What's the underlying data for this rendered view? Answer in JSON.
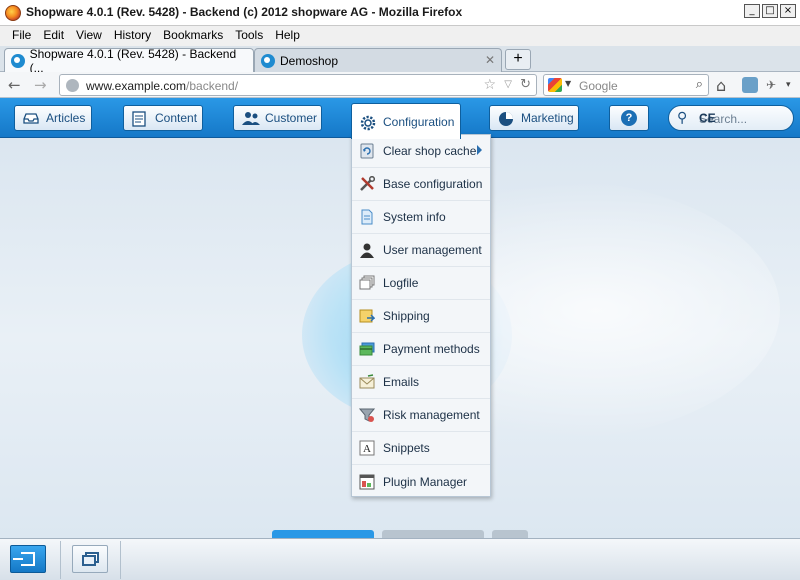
{
  "window": {
    "title": "Shopware 4.0.1 (Rev. 5428) - Backend (c) 2012 shopware AG - Mozilla Firefox",
    "controls": [
      "_",
      "□",
      "×"
    ]
  },
  "menubar": {
    "items": [
      "File",
      "Edit",
      "View",
      "History",
      "Bookmarks",
      "Tools",
      "Help"
    ]
  },
  "tabs": [
    {
      "label": "Shopware 4.0.1 (Rev. 5428) - Backend (...",
      "active": true
    },
    {
      "label": "Demoshop",
      "active": false
    }
  ],
  "newtab_label": "+",
  "nav": {
    "back": "←",
    "forward": "→",
    "url_host": "www.example.com",
    "url_path": "/backend/",
    "star": "☆",
    "dropdown": "▽",
    "reload": "↻",
    "search_placeholder": "Google",
    "search_icon": "search-icon",
    "home": "⌂",
    "addon": "✈",
    "menu_arrow": "▾"
  },
  "app_toolbar": {
    "buttons": [
      {
        "label": "Articles",
        "icon": "articles-icon"
      },
      {
        "label": "Content",
        "icon": "content-icon"
      },
      {
        "label": "Customer",
        "icon": "customer-icon"
      },
      {
        "label": "Configuration",
        "icon": "gear-icon"
      },
      {
        "label": "Marketing",
        "icon": "pie-chart-icon"
      }
    ],
    "help_label": "?",
    "search_placeholder": "Search...",
    "search_typed": "CE"
  },
  "configuration_menu": {
    "items": [
      {
        "label": "Clear shop cache",
        "icon": "cache-icon",
        "submenu": true
      },
      {
        "label": "Base configuration",
        "icon": "tools-icon"
      },
      {
        "label": "System info",
        "icon": "document-icon"
      },
      {
        "label": "User management",
        "icon": "user-icon"
      },
      {
        "label": "Logfile",
        "icon": "logfile-icon"
      },
      {
        "label": "Shipping",
        "icon": "shipping-icon"
      },
      {
        "label": "Payment methods",
        "icon": "payment-icon"
      },
      {
        "label": "Emails",
        "icon": "email-icon"
      },
      {
        "label": "Risk management",
        "icon": "filter-icon"
      },
      {
        "label": "Snippets",
        "icon": "snippets-icon"
      },
      {
        "label": "Plugin Manager",
        "icon": "plugin-icon"
      }
    ]
  },
  "taskbar": {
    "exit_icon": "logout-icon",
    "windows_icon": "windows-icon"
  },
  "colors": {
    "toolbar_blue": "#1f8ad8",
    "dropdown_bg": "#f3f6f9",
    "text_blue": "#1b4f80"
  }
}
